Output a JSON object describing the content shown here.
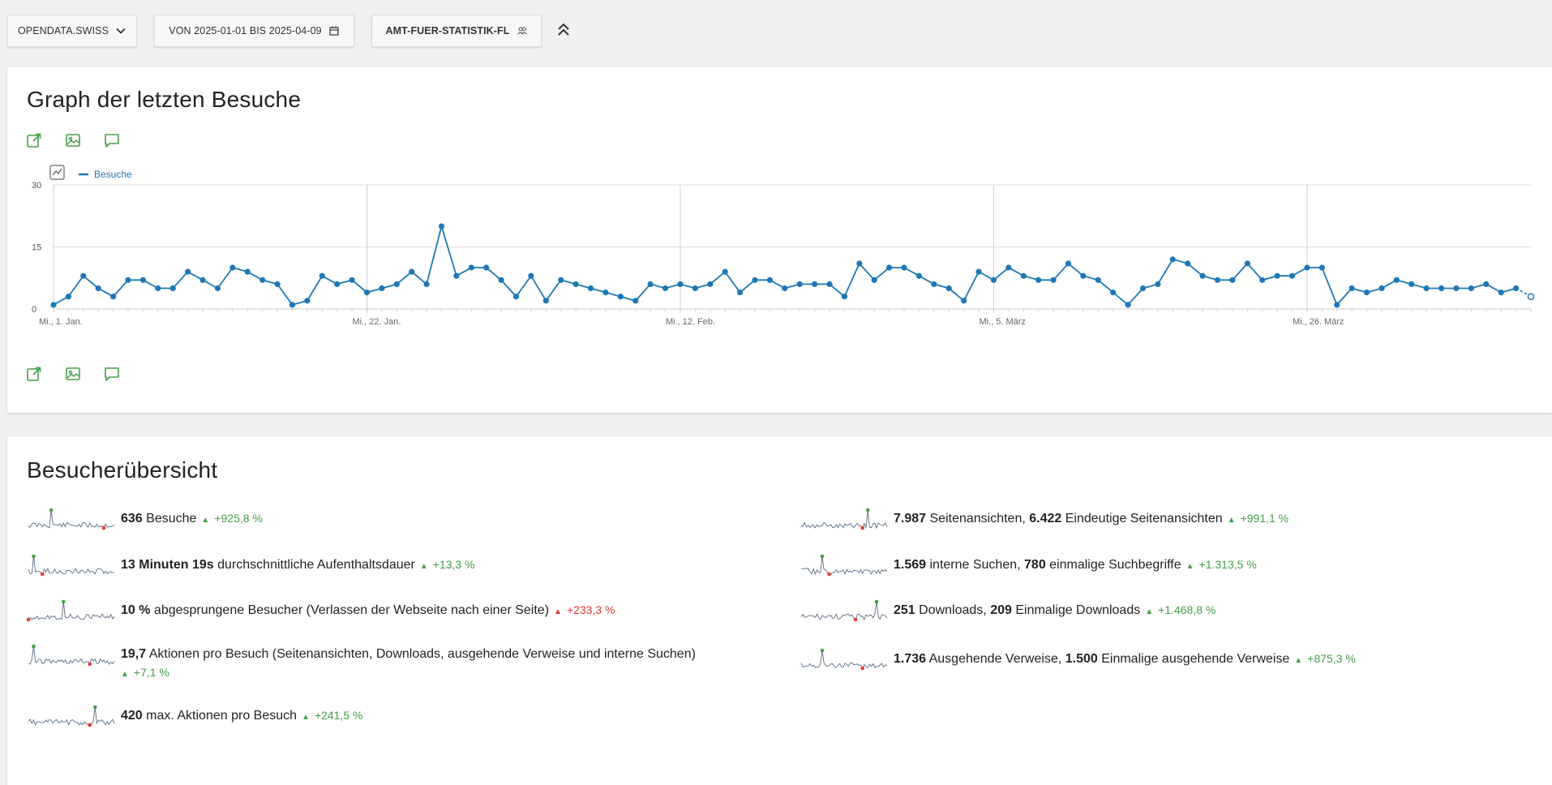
{
  "toolbar": {
    "site_label": "OPENDATA.SWISS",
    "date_range_label": "VON 2025-01-01 BIS 2025-04-09",
    "segment_label": "AMT-FUER-STATISTIK-FL"
  },
  "graph_card": {
    "title": "Graph der letzten Besuche",
    "legend_label": "Besuche"
  },
  "chart_data": {
    "type": "line",
    "series": [
      {
        "name": "Besuche",
        "values": [
          1,
          3,
          8,
          5,
          3,
          7,
          7,
          5,
          5,
          9,
          7,
          5,
          10,
          9,
          7,
          6,
          1,
          2,
          8,
          6,
          7,
          4,
          5,
          6,
          9,
          6,
          20,
          8,
          10,
          10,
          7,
          3,
          8,
          2,
          7,
          6,
          5,
          4,
          3,
          2,
          6,
          5,
          6,
          5,
          6,
          9,
          4,
          7,
          7,
          5,
          6,
          6,
          6,
          3,
          11,
          7,
          10,
          10,
          8,
          6,
          5,
          2,
          9,
          7,
          10,
          8,
          7,
          7,
          11,
          8,
          7,
          4,
          1,
          5,
          6,
          12,
          11,
          8,
          7,
          7,
          11,
          7,
          8,
          8,
          10,
          10,
          1,
          5,
          4,
          5,
          7,
          6,
          5,
          5,
          5,
          5,
          6,
          4,
          5,
          3
        ]
      }
    ],
    "x_tick_labels": [
      "Mi., 1. Jan.",
      "Mi., 22. Jan.",
      "Mi., 12. Feb.",
      "Mi., 5. März",
      "Mi., 26. März"
    ],
    "x_tick_indices": [
      0,
      21,
      42,
      63,
      84
    ],
    "y_ticks": [
      "0",
      "15",
      "30"
    ],
    "ylim": [
      0,
      30
    ],
    "grid": true,
    "colors": {
      "line": "#1f78b4",
      "accent": "#43a047",
      "negative": "#e53935"
    }
  },
  "overview": {
    "title": "Besucherübersicht",
    "left": [
      {
        "value": "636",
        "text": " Besuche",
        "delta": "+925,8 %",
        "trend": "up"
      },
      {
        "value": "13 Minuten 19s",
        "text": " durchschnittliche Aufenthaltsdauer",
        "delta": "+13,3 %",
        "trend": "up"
      },
      {
        "value": "10 %",
        "text": " abgesprungene Besucher (Verlassen der Webseite nach einer Seite)",
        "delta": "+233,3 %",
        "trend": "up-bad"
      },
      {
        "value": "19,7",
        "text": " Aktionen pro Besuch (Seitenansichten, Downloads, ausgehende Verweise und interne Suchen)",
        "delta": "+7,1 %",
        "trend": "up"
      },
      {
        "value": "420",
        "text": " max. Aktionen pro Besuch",
        "delta": "+241,5 %",
        "trend": "up"
      }
    ],
    "right": [
      {
        "value": "7.987",
        "text": " Seitenansichten, ",
        "value2": "6.422",
        "text2": " Eindeutige Seitenansichten",
        "delta": "+991,1 %",
        "trend": "up"
      },
      {
        "value": "1.569",
        "text": " interne Suchen, ",
        "value2": "780",
        "text2": " einmalige Suchbegriffe",
        "delta": "+1.313,5 %",
        "trend": "up"
      },
      {
        "value": "251",
        "text": " Downloads, ",
        "value2": "209",
        "text2": " Einmalige Downloads",
        "delta": "+1.468,8 %",
        "trend": "up"
      },
      {
        "value": "1.736",
        "text": " Ausgehende Verweise, ",
        "value2": "1.500",
        "text2": " Einmalige ausgehende Verweise",
        "delta": "+875,3 %",
        "trend": "up"
      }
    ]
  }
}
